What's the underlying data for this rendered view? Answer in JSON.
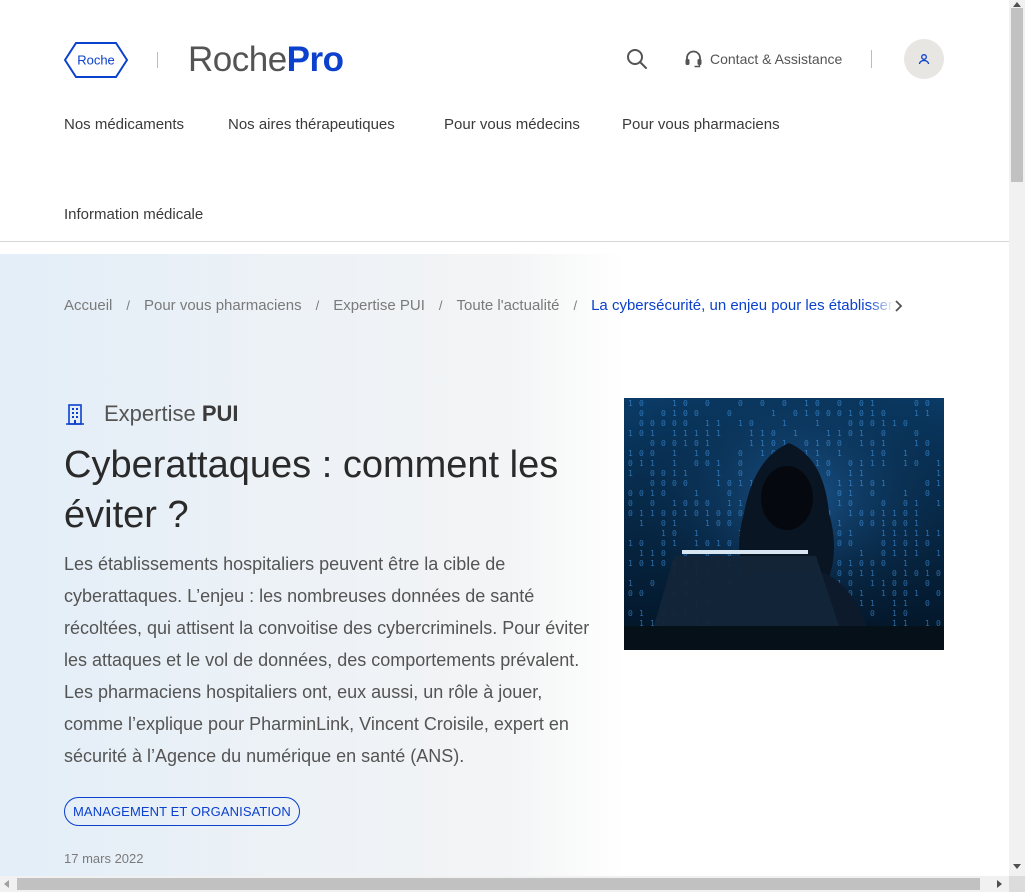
{
  "header": {
    "logo_text": "Roche",
    "brand_name_1": "Roche",
    "brand_name_2": "Pro",
    "search_icon": "search-icon",
    "contact_label": "Contact & Assistance",
    "contact_icon": "headset-icon",
    "avatar_icon": "user-icon",
    "brand_color": "#0b41cd"
  },
  "nav": {
    "items": [
      "Nos médicaments",
      "Nos aires thérapeutiques",
      "Pour vous médecins",
      "Pour vous pharmaciens",
      "Information médicale"
    ]
  },
  "breadcrumb": {
    "items": [
      "Accueil",
      "Pour vous pharmaciens",
      "Expertise PUI",
      "Toute l'actualité"
    ],
    "separator": "/",
    "current": "La cybersécurité, un enjeu pour les établissements de santé"
  },
  "article": {
    "category_icon": "hospital-building-icon",
    "category_prefix": "Expertise",
    "category_strong": "PUI",
    "title": "Cyberattaques : comment les éviter ?",
    "intro": "Les établissements hospitaliers peuvent être la cible de cyberattaques. L’enjeu : les nombreuses données de santé récoltées, qui attisent la convoitise des cybercriminels. Pour éviter les attaques et le vol de données, des comportements prévalent. Les pharmaciens hospitaliers ont, eux aussi, un rôle à jouer, comme l’explique pour PharminLink, Vincent Croisile, expert en sécurité à l’Agence du numérique en santé (ANS).",
    "tag": "MANAGEMENT ET ORGANISATION",
    "date": "17 mars 2022",
    "image_alt": "hooded-hacker-binary-image"
  }
}
